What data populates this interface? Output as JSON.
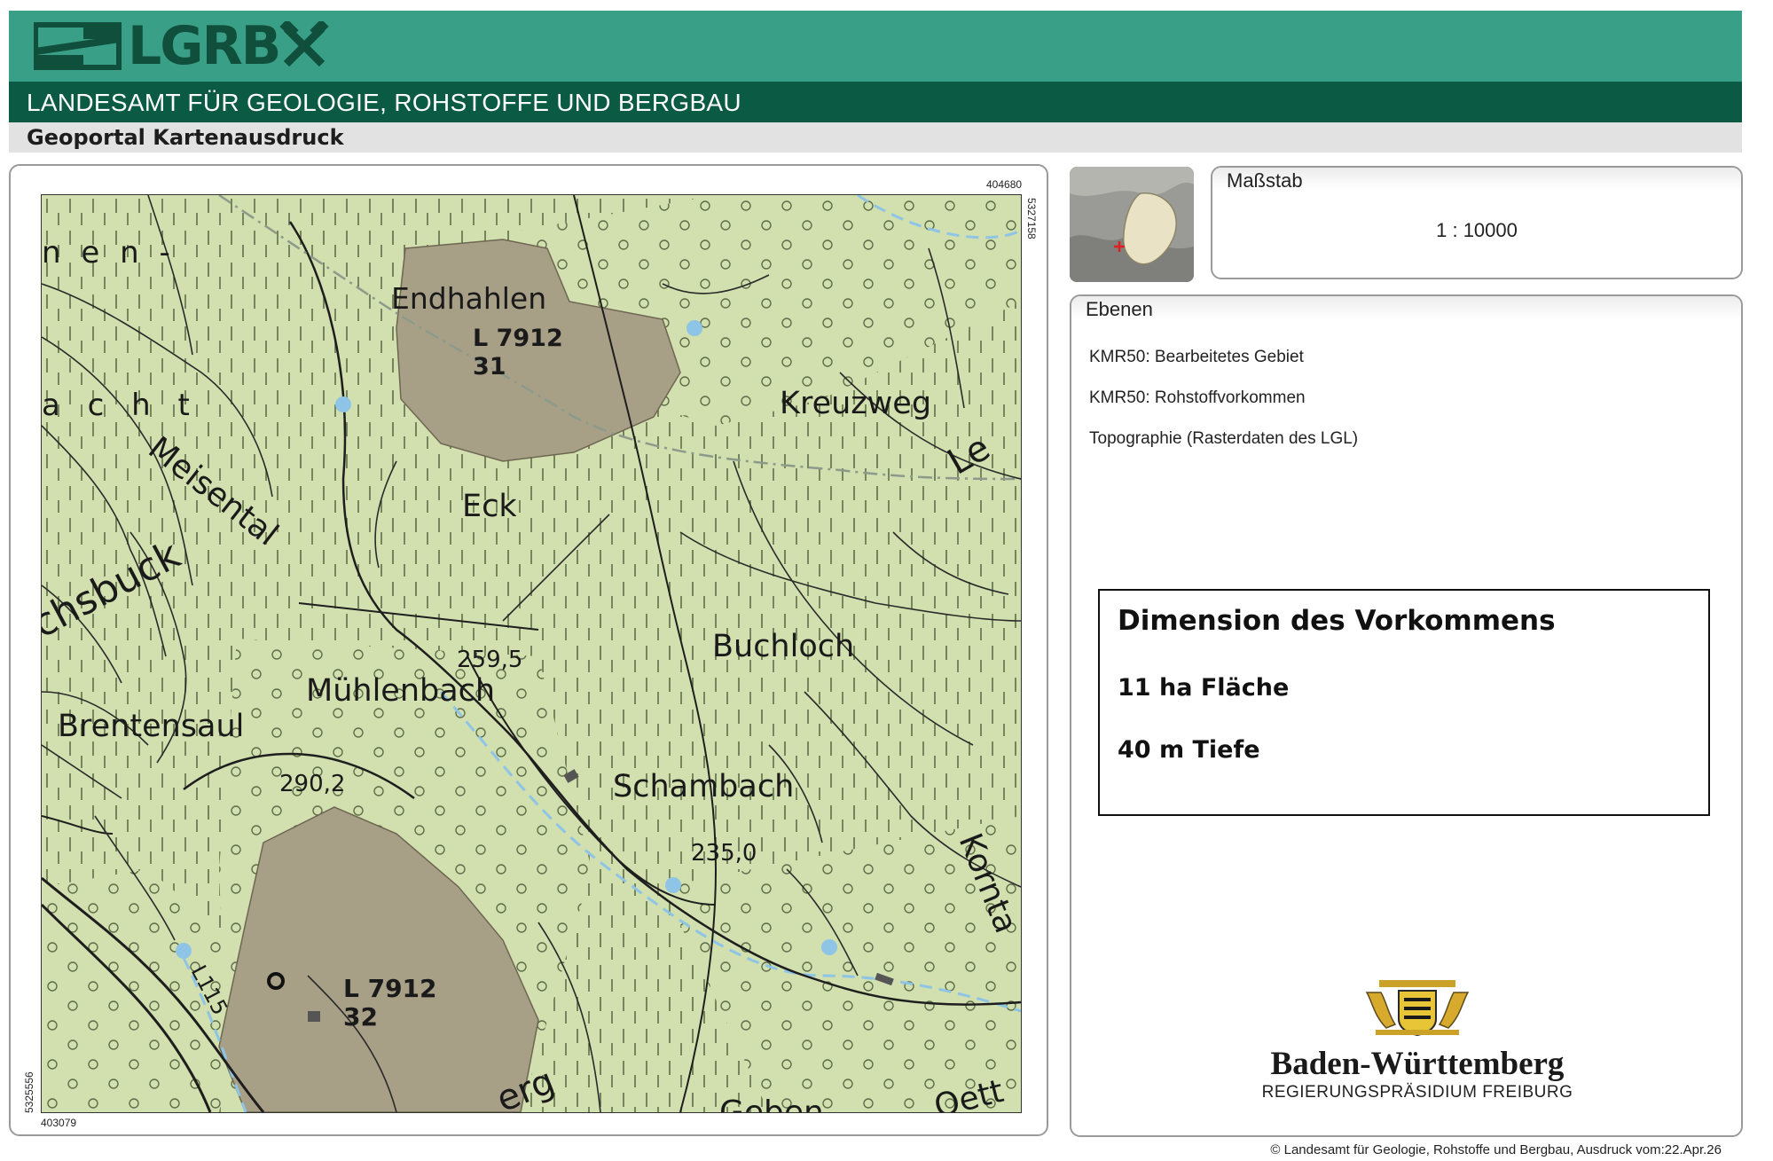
{
  "header": {
    "logo_text": "LGRB",
    "agency": "LANDESAMT FÜR GEOLOGIE, ROHSTOFFE UND BERGBAU",
    "subtitle": "Geoportal Kartenausdruck",
    "colors": {
      "header_bar": "#3a9f87",
      "agency_bar": "#0a5a44",
      "subtitle_bar": "#e2e2e2"
    }
  },
  "map": {
    "coords": {
      "top_right": "404680",
      "right_top": "5327158",
      "bottom_left": "403079",
      "left_bottom": "5325556"
    },
    "labels": {
      "endhahlen": "Endhahlen",
      "l7912_31_a": "L 7912",
      "l7912_31_b": "31",
      "kreuzweg": "Kreuzweg",
      "eck": "Eck",
      "meisental": "Meisental",
      "chsbuck": "chsbuck",
      "nen": "n e n -",
      "acht": "a c h t",
      "le": "Le",
      "buchloch": "Buchloch",
      "height_259": "259,5",
      "muhlenbach": "Mühlenbach",
      "brentensaul": "Brentensaul",
      "height_290": "290,2",
      "schambach": "Schambach",
      "height_235": "235,0",
      "korntal": "Kornta",
      "l115": "L115",
      "l7912_32_a": "L 7912",
      "l7912_32_b": "32",
      "erg": "erg",
      "gehen": "Geben",
      "ott": "Oett"
    },
    "colors": {
      "base": "#d2dfae",
      "deposit": "#a89f87",
      "stream": "#8ec4e6",
      "line": "#1e1e1e"
    }
  },
  "scale": {
    "title": "Maßstab",
    "value": "1 : 10000"
  },
  "layers": {
    "title": "Ebenen",
    "items": [
      "KMR50: Bearbeitetes Gebiet",
      "KMR50: Rohstoffvorkommen",
      "Topographie (Rasterdaten des LGL)"
    ]
  },
  "dimension": {
    "title": "Dimension des Vorkommens",
    "area": "11 ha Fläche",
    "depth": "40 m Tiefe"
  },
  "bw": {
    "name": "Baden-Württemberg",
    "sub": "REGIERUNGSPRÄSIDIUM FREIBURG"
  },
  "footer": "© Landesamt für Geologie, Rohstoffe und Bergbau, Ausdruck vom:22.Apr.26"
}
